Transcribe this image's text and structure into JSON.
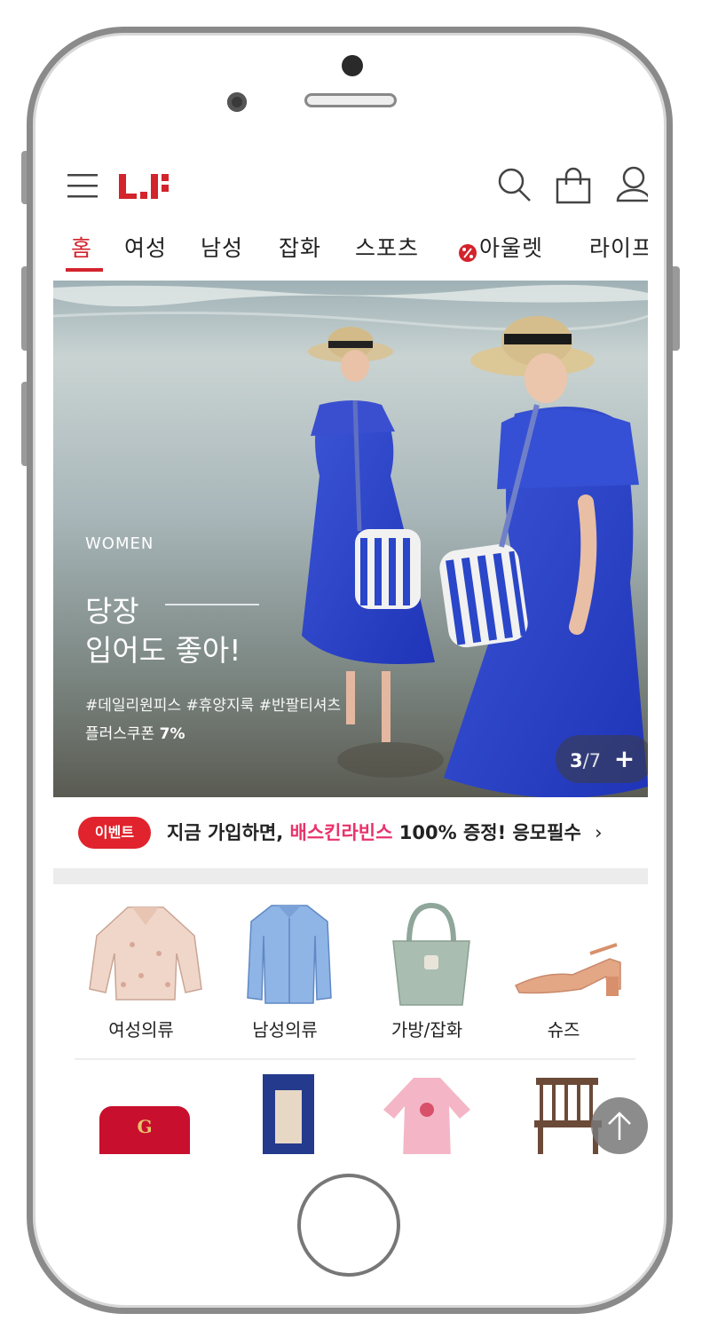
{
  "header": {
    "logo": "LF",
    "menu_icon": "hamburger-icon",
    "search_icon": "search-icon",
    "cart_icon": "shopping-bag-icon",
    "user_icon": "user-icon"
  },
  "nav": {
    "tabs": [
      {
        "label": "홈",
        "active": true
      },
      {
        "label": "여성",
        "active": false
      },
      {
        "label": "남성",
        "active": false
      },
      {
        "label": "잡화",
        "active": false
      },
      {
        "label": "스포츠",
        "active": false
      },
      {
        "label": "아울렛",
        "active": false,
        "icon": "percent-badge-icon"
      },
      {
        "label": "라이프",
        "active": false
      }
    ]
  },
  "hero": {
    "category": "WOMEN",
    "headline_line1": "당장",
    "headline_line2": "입어도 좋아!",
    "tags": "#데일리원피스 #휴양지룩 #반팔티셔츠",
    "coupon_prefix": "플러스쿠폰",
    "coupon_value": "7%",
    "pager_current": "3",
    "pager_total": "/7",
    "pager_more": "+"
  },
  "event": {
    "badge": "이벤트",
    "text_prefix": "지금 가입하면,",
    "text_highlight": "배스킨라빈스",
    "text_suffix": "100% 증정! 응모필수",
    "chevron": "›"
  },
  "categories": [
    {
      "label": "여성의류",
      "icon": "blouse-image"
    },
    {
      "label": "남성의류",
      "icon": "shirt-image"
    },
    {
      "label": "가방/잡화",
      "icon": "handbag-image"
    },
    {
      "label": "슈즈",
      "icon": "shoe-image"
    }
  ],
  "colors": {
    "brand_red": "#d3232c",
    "highlight_pink": "#e8336d"
  }
}
